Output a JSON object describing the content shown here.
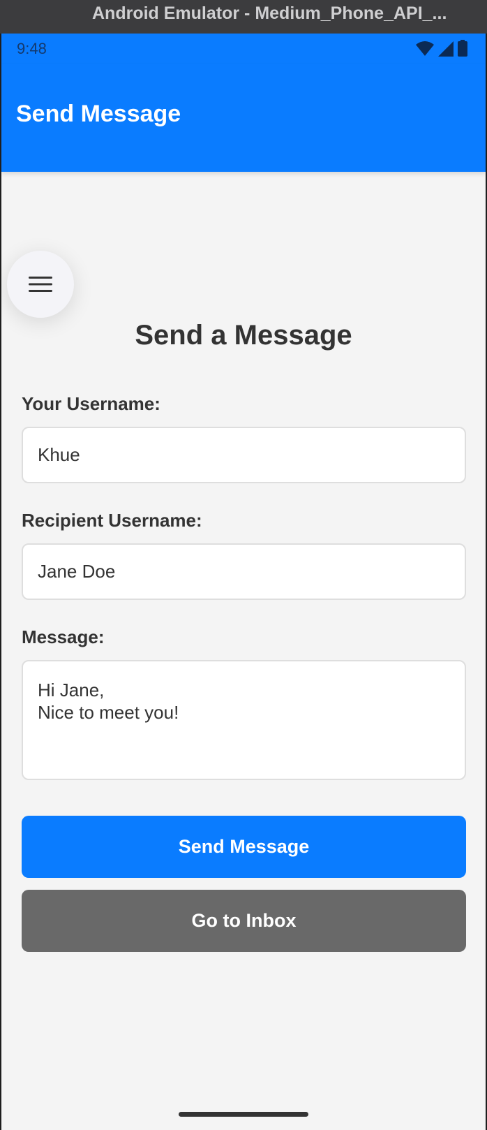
{
  "window": {
    "title": "Android Emulator - Medium_Phone_API_..."
  },
  "status_bar": {
    "time": "9:48"
  },
  "app_bar": {
    "title": "Send Message"
  },
  "content": {
    "title": "Send a Message",
    "username_label": "Your Username:",
    "username_value": "Khue",
    "recipient_label": "Recipient Username:",
    "recipient_value": "Jane Doe",
    "message_label": "Message:",
    "message_line1": "Hi Jane,",
    "message_line2": "Nice to meet you!",
    "send_button": "Send Message",
    "inbox_button": "Go to Inbox"
  },
  "icons": {
    "menu": "menu-icon",
    "wifi": "wifi-icon",
    "signal": "signal-icon",
    "battery": "battery-icon"
  },
  "colors": {
    "primary": "#0a7cff",
    "secondary_button": "#696969",
    "background": "#f4f4f4"
  }
}
